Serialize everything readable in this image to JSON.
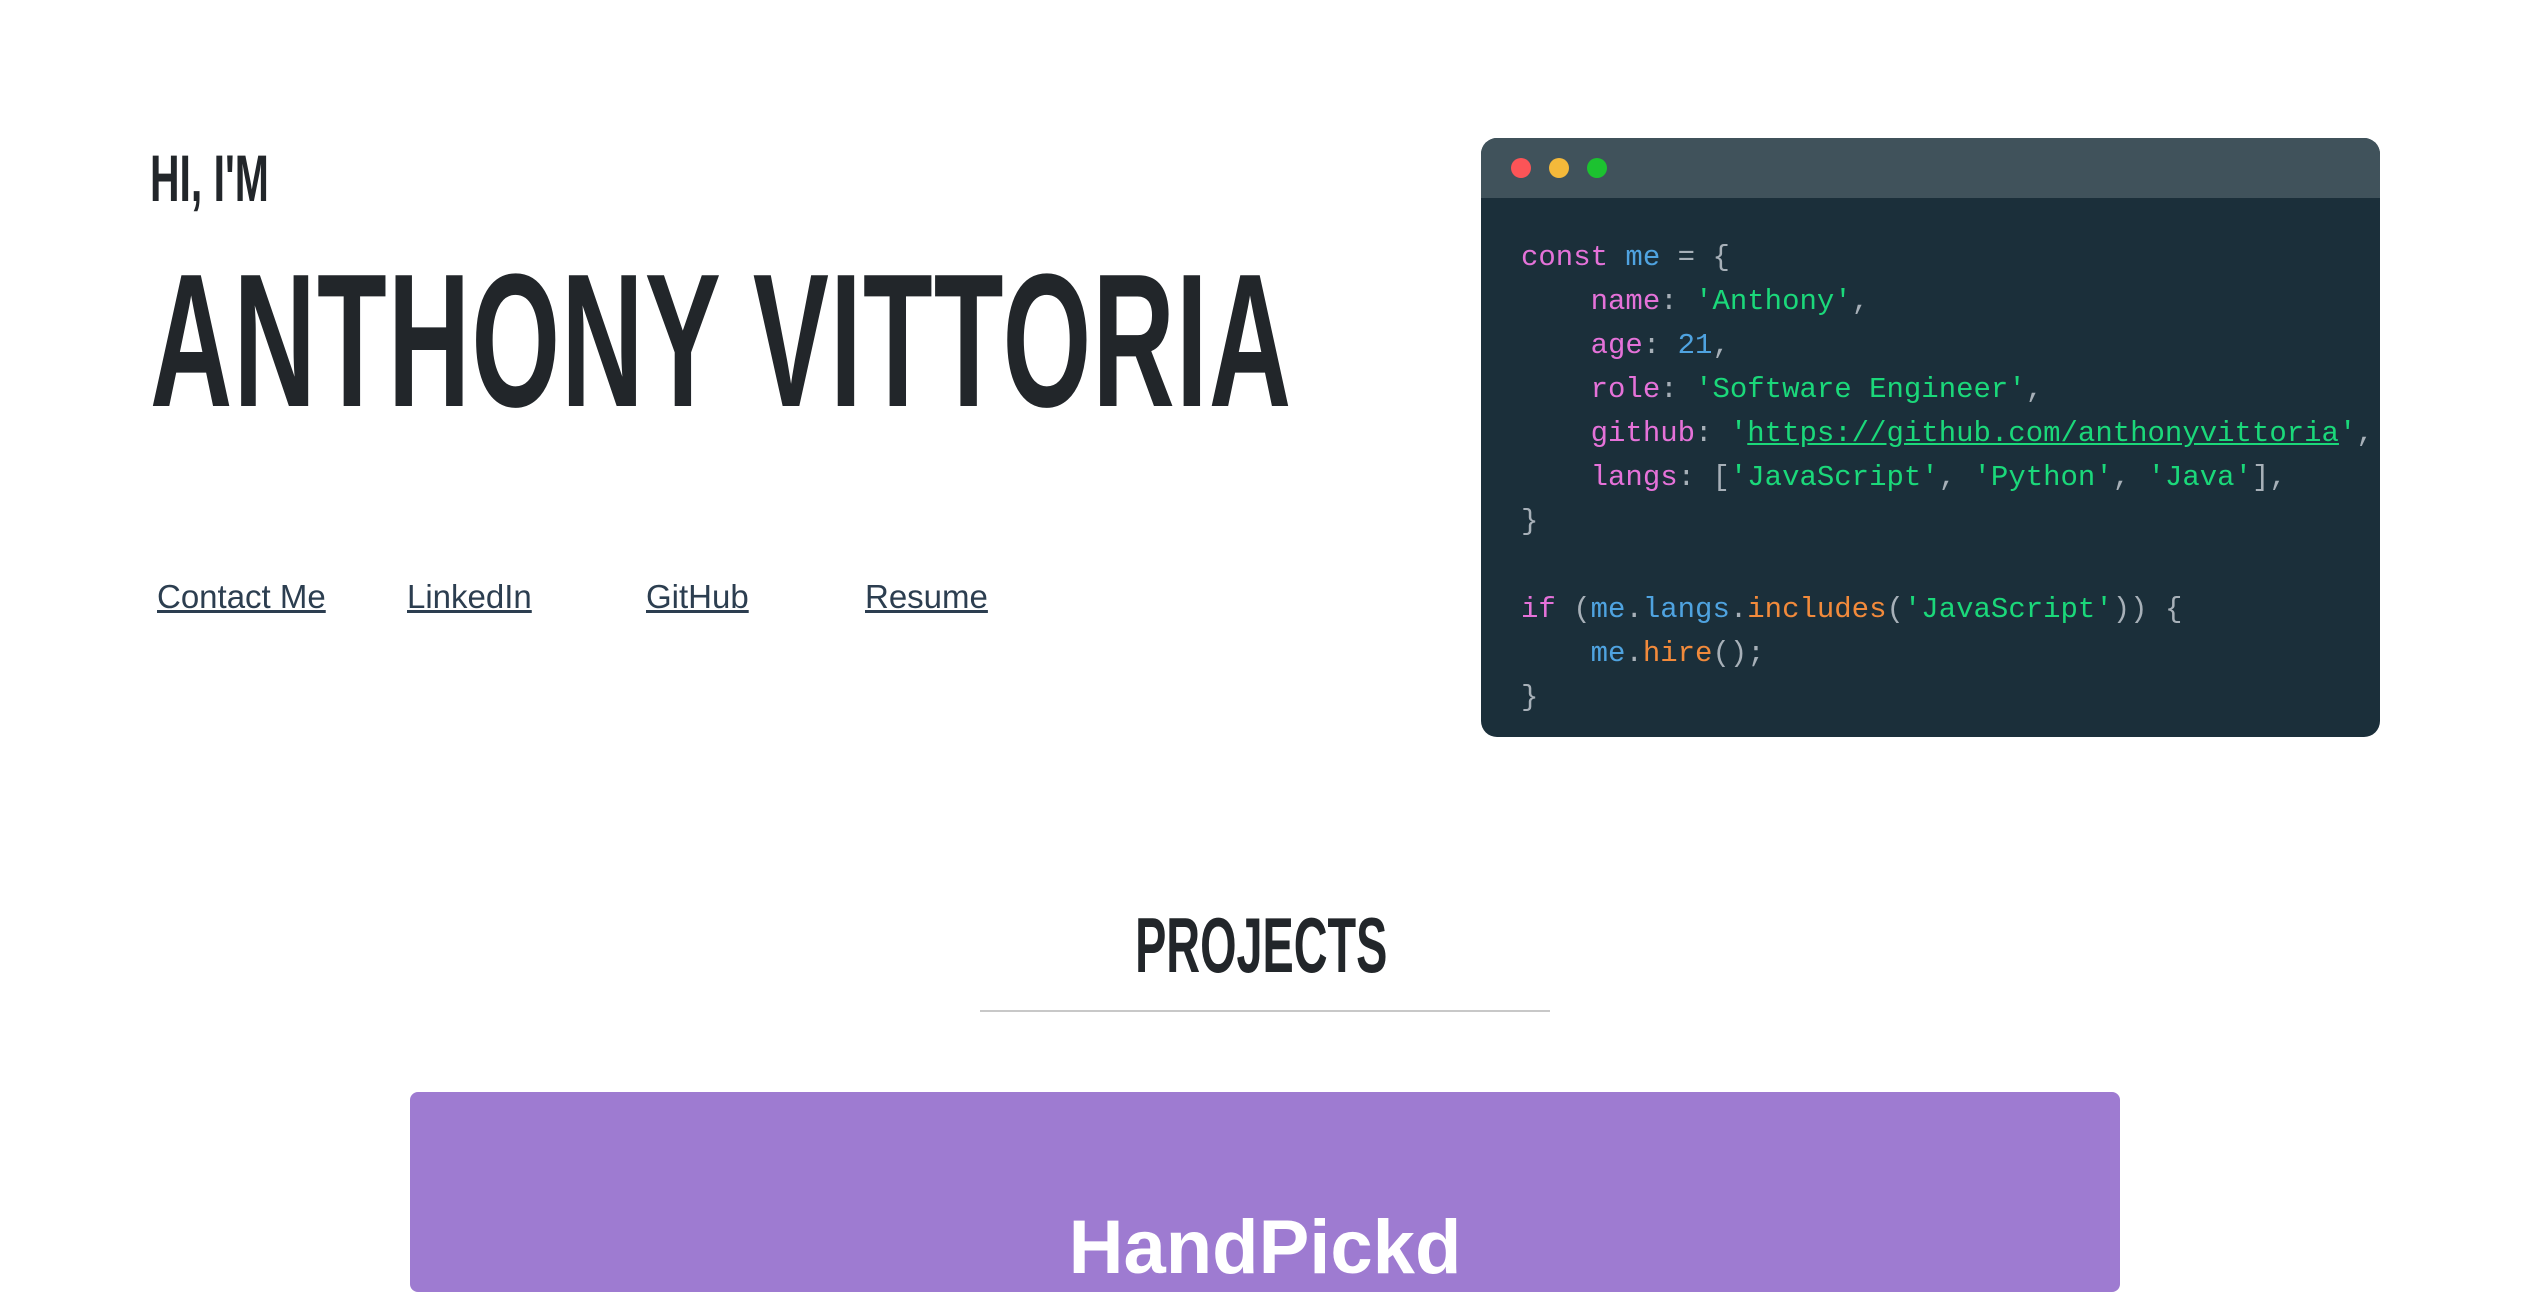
{
  "hero": {
    "greeting": "HI, I'M",
    "name": "ANTHONY VITTORIA"
  },
  "links": [
    "Contact Me",
    "LinkedIn",
    "GitHub",
    "Resume"
  ],
  "code_window": {
    "dots": {
      "red": "#fc5457",
      "yellow": "#f5b93a",
      "green": "#1cc230"
    },
    "lines": {
      "const": "const",
      "me": "me",
      "name_key": "name",
      "name_val": "'Anthony'",
      "age_key": "age",
      "age_val": "21",
      "role_key": "role",
      "role_val": "'Software Engineer'",
      "github_key": "github",
      "github_url": "https://github.com/anthonyvittoria",
      "langs_key": "langs",
      "lang1": "'JavaScript'",
      "lang2": "'Python'",
      "lang3": "'Java'",
      "if": "if",
      "langs": "langs",
      "includes": "includes",
      "js": "'JavaScript'",
      "hire": "hire"
    }
  },
  "projects": {
    "heading": "PROJECTS",
    "cards": [
      {
        "title": "HandPickd",
        "color": "#9e7bd1"
      }
    ]
  }
}
